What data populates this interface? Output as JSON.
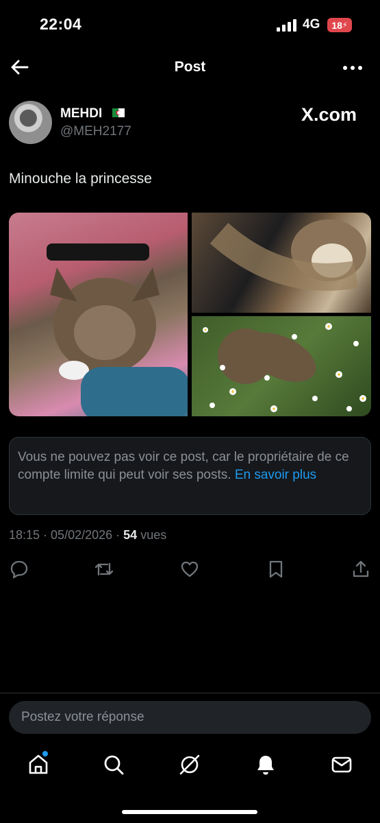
{
  "status": {
    "time": "22:04",
    "network": "4G",
    "battery_text": "18"
  },
  "header": {
    "title": "Post"
  },
  "author": {
    "name": "MEHDI",
    "handle": "@MEH2177",
    "source": "X.com"
  },
  "post": {
    "text": "Minouche la princesse",
    "notice": "Vous ne pouvez pas voir ce post, car le propriétaire de ce compte limite qui peut voir ses posts. ",
    "notice_link": "En savoir plus",
    "time": "18:15",
    "date": "05/02/2026",
    "views_count": "54",
    "views_label": "vues"
  },
  "actions": {
    "reply_icon": "reply-icon",
    "repost_icon": "repost-icon",
    "like_icon": "heart-icon",
    "bookmark_icon": "bookmark-icon",
    "share_icon": "share-icon"
  },
  "reply_box": {
    "placeholder": "Postez votre réponse"
  },
  "bottom_nav": {
    "items": [
      "home-icon",
      "search-icon",
      "grok-icon",
      "notifications-icon",
      "messages-icon"
    ]
  },
  "colors": {
    "background": "#000000",
    "accent": "#1d9bf0",
    "muted": "#71767b",
    "battery": "#e0474c"
  }
}
